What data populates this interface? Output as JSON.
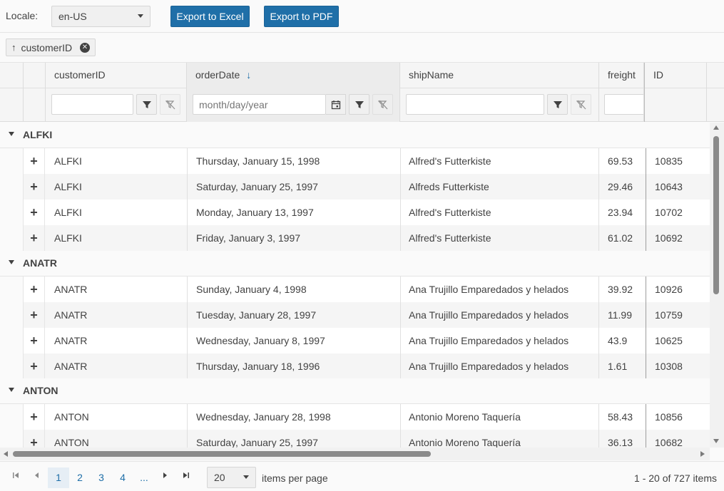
{
  "toolbar": {
    "locale_label": "Locale:",
    "locale_value": "en-US",
    "export_excel": "Export to Excel",
    "export_pdf": "Export to PDF"
  },
  "group_panel": {
    "chip_arrow": "↑",
    "chip_label": "customerID"
  },
  "columns": [
    {
      "label": "customerID"
    },
    {
      "label": "orderDate",
      "sort_arrow": "↓"
    },
    {
      "label": "shipName"
    },
    {
      "label": "freight"
    },
    {
      "label": "ID"
    }
  ],
  "filters": {
    "date_placeholder": "month/day/year"
  },
  "groups": [
    {
      "name": "ALFKI",
      "rows": [
        {
          "expand": "+",
          "customerID": "ALFKI",
          "orderDate": "Thursday, January 15, 1998",
          "shipName": "Alfred's Futterkiste",
          "freight": "69.53",
          "id": "10835"
        },
        {
          "expand": "+",
          "customerID": "ALFKI",
          "orderDate": "Saturday, January 25, 1997",
          "shipName": "Alfreds Futterkiste",
          "freight": "29.46",
          "id": "10643"
        },
        {
          "expand": "+",
          "customerID": "ALFKI",
          "orderDate": "Monday, January 13, 1997",
          "shipName": "Alfred's Futterkiste",
          "freight": "23.94",
          "id": "10702"
        },
        {
          "expand": "+",
          "customerID": "ALFKI",
          "orderDate": "Friday, January 3, 1997",
          "shipName": "Alfred's Futterkiste",
          "freight": "61.02",
          "id": "10692"
        }
      ]
    },
    {
      "name": "ANATR",
      "rows": [
        {
          "expand": "+",
          "customerID": "ANATR",
          "orderDate": "Sunday, January 4, 1998",
          "shipName": "Ana Trujillo Emparedados y helados",
          "freight": "39.92",
          "id": "10926"
        },
        {
          "expand": "+",
          "customerID": "ANATR",
          "orderDate": "Tuesday, January 28, 1997",
          "shipName": "Ana Trujillo Emparedados y helados",
          "freight": "11.99",
          "id": "10759"
        },
        {
          "expand": "+",
          "customerID": "ANATR",
          "orderDate": "Wednesday, January 8, 1997",
          "shipName": "Ana Trujillo Emparedados y helados",
          "freight": "43.9",
          "id": "10625"
        },
        {
          "expand": "+",
          "customerID": "ANATR",
          "orderDate": "Thursday, January 18, 1996",
          "shipName": "Ana Trujillo Emparedados y helados",
          "freight": "1.61",
          "id": "10308"
        }
      ]
    },
    {
      "name": "ANTON",
      "rows": [
        {
          "expand": "+",
          "customerID": "ANTON",
          "orderDate": "Wednesday, January 28, 1998",
          "shipName": "Antonio Moreno Taquería",
          "freight": "58.43",
          "id": "10856"
        },
        {
          "expand": "+",
          "customerID": "ANTON",
          "orderDate": "Saturday, January 25, 1997",
          "shipName": "Antonio Moreno Taquería",
          "freight": "36.13",
          "id": "10682"
        }
      ]
    }
  ],
  "pager": {
    "pages": [
      "1",
      "2",
      "3",
      "4",
      "..."
    ],
    "current_page": "1",
    "page_size": "20",
    "items_per_page_label": "items per page",
    "info": "1 - 20 of 727 items"
  },
  "colors": {
    "primary": "#1f6fa8",
    "text": "#424242",
    "alt_row": "#f5f5f5"
  }
}
